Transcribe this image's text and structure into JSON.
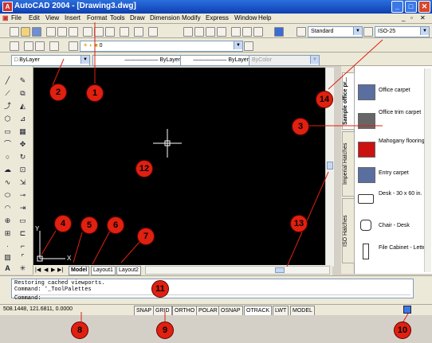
{
  "window": {
    "title": "AutoCAD 2004 - [Drawing3.dwg]",
    "app_icon": "A",
    "min": "_",
    "max": "□",
    "close": "✕"
  },
  "menu": [
    "File",
    "Edit",
    "View",
    "Insert",
    "Format",
    "Tools",
    "Draw",
    "Dimension",
    "Modify",
    "Express",
    "Window",
    "Help"
  ],
  "styles_toolbar": {
    "text_style": "Standard",
    "dim_style": "ISO-25"
  },
  "layers_toolbar": {
    "layer": "0"
  },
  "properties_toolbar": {
    "color": "ByLayer",
    "linetype": "ByLayer",
    "lineweight": "ByLayer",
    "plotstyle": "ByColor"
  },
  "layout_tabs": [
    "Model",
    "Layout1",
    "Layout2"
  ],
  "ucs": {
    "y": "Y",
    "x": "X"
  },
  "palette": {
    "tabs": [
      "Sample office pr...",
      "Imperial Hatches",
      "ISO Hatches"
    ],
    "items": [
      {
        "label": "Office carpet",
        "color": "#5a6fa0"
      },
      {
        "label": "Office trim carpet",
        "color": "#666666"
      },
      {
        "label": "Mahogany flooring",
        "color": "#cc1111"
      },
      {
        "label": "Entry carpet",
        "color": "#5a6fa0"
      },
      {
        "label": "Desk - 30 x 60 in.",
        "icon": "desk-icon"
      },
      {
        "label": "Chair - Desk",
        "icon": "chair-icon"
      },
      {
        "label": "File Cabinet - Letter",
        "icon": "cabinet-icon"
      }
    ]
  },
  "command": {
    "line1": "Restoring cached viewports.",
    "line2": "Command: '_ToolPalettes",
    "prompt": "Command:"
  },
  "status": {
    "coords": "508.1448, 121.6811, 0.0000",
    "buttons": [
      "SNAP",
      "GRID",
      "ORTHO",
      "POLAR",
      "OSNAP",
      "OTRACK",
      "LWT",
      "MODEL"
    ]
  },
  "callouts": [
    "1",
    "2",
    "3",
    "4",
    "5",
    "6",
    "7",
    "8",
    "9",
    "10",
    "11",
    "12",
    "13",
    "14"
  ],
  "colors": {
    "callout": "#e02010",
    "titlebar": "#1a52c4",
    "canvas": "#000000"
  }
}
